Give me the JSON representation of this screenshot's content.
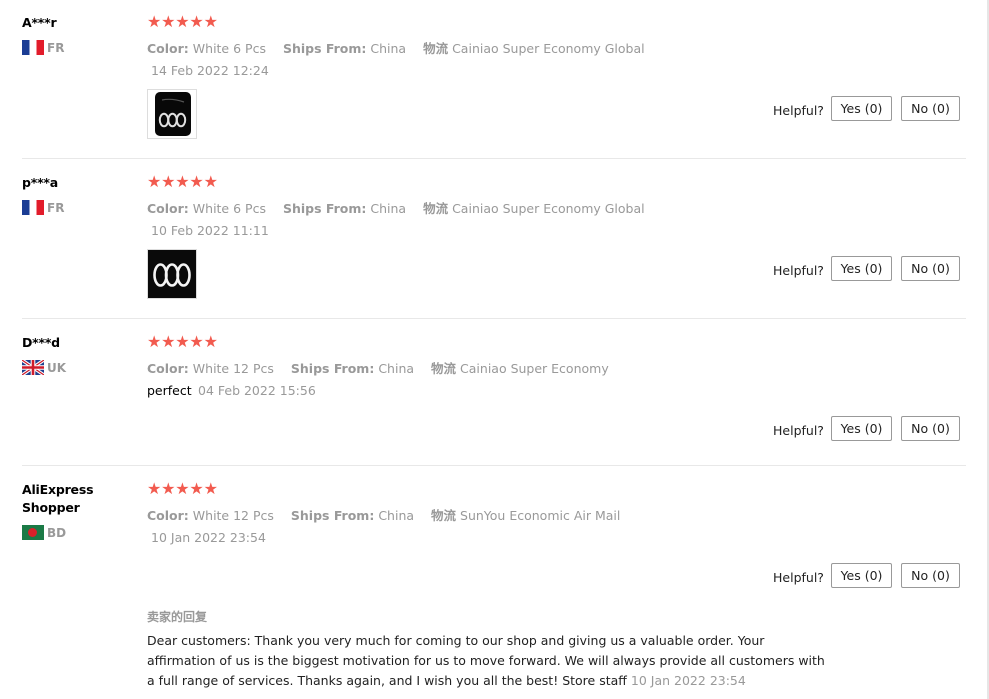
{
  "reviews": [
    {
      "user": "A***r",
      "country": "FR",
      "stars": "★★★★★",
      "color_label": "Color:",
      "color_value": "White 6 Pcs",
      "ships_label": "Ships From:",
      "ships_value": "China",
      "logistics_label": "物流",
      "logistics_value": "Cainiao Super Economy Global",
      "feedback": "",
      "date": "14 Feb 2022 12:24",
      "helpful_label": "Helpful?",
      "yes_label": "Yes (0)",
      "no_label": "No (0)"
    },
    {
      "user": "p***a",
      "country": "FR",
      "stars": "★★★★★",
      "color_label": "Color:",
      "color_value": "White 6 Pcs",
      "ships_label": "Ships From:",
      "ships_value": "China",
      "logistics_label": "物流",
      "logistics_value": "Cainiao Super Economy Global",
      "feedback": "",
      "date": "10 Feb 2022 11:11",
      "helpful_label": "Helpful?",
      "yes_label": "Yes (0)",
      "no_label": "No (0)"
    },
    {
      "user": "D***d",
      "country": "UK",
      "stars": "★★★★★",
      "color_label": "Color:",
      "color_value": "White 12 Pcs",
      "ships_label": "Ships From:",
      "ships_value": "China",
      "logistics_label": "物流",
      "logistics_value": "Cainiao Super Economy",
      "feedback": "perfect",
      "date": "04 Feb 2022 15:56",
      "helpful_label": "Helpful?",
      "yes_label": "Yes (0)",
      "no_label": "No (0)"
    },
    {
      "user_line1": "AliExpress",
      "user_line2": "Shopper",
      "country": "BD",
      "stars": "★★★★★",
      "color_label": "Color:",
      "color_value": "White 12 Pcs",
      "ships_label": "Ships From:",
      "ships_value": "China",
      "logistics_label": "物流",
      "logistics_value": "SunYou Economic Air Mail",
      "feedback": "",
      "date": "10 Jan 2022 23:54",
      "helpful_label": "Helpful?",
      "yes_label": "Yes (0)",
      "no_label": "No (0)",
      "seller_reply": {
        "title": "卖家的回复",
        "text": "Dear customers: Thank you very much for coming to our shop and giving us a valuable order. Your affirmation of us is the biggest motivation for us to move forward. We will always provide all customers with a full range of services. Thanks again, and I wish you all the best! Store staff",
        "date": "10 Jan 2022 23:54"
      }
    }
  ],
  "colors": {
    "star": "#f25b4f",
    "muted_text": "#999999",
    "divider": "#e8e8e8"
  }
}
